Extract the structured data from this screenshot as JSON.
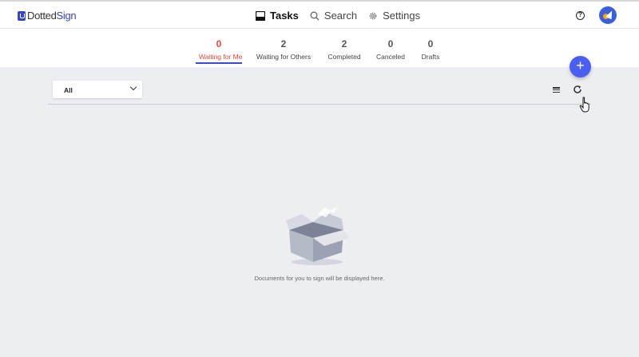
{
  "app": {
    "logo_plain": "Dotted",
    "logo_brand": "Sign"
  },
  "nav": {
    "items": [
      {
        "label": "Tasks",
        "icon": "inbox-icon",
        "active": true
      },
      {
        "label": "Search",
        "icon": "search-icon",
        "active": false
      },
      {
        "label": "Settings",
        "icon": "gear-icon",
        "active": false
      }
    ],
    "help_glyph": "?"
  },
  "status_tabs": [
    {
      "count": "0",
      "label": "Waiting for Me",
      "active": true
    },
    {
      "count": "2",
      "label": "Waiting for Others",
      "active": false
    },
    {
      "count": "2",
      "label": "Completed",
      "active": false
    },
    {
      "count": "0",
      "label": "Canceled",
      "active": false
    },
    {
      "count": "0",
      "label": "Drafts",
      "active": false
    }
  ],
  "fab": {
    "glyph": "+"
  },
  "filter": {
    "selected": "All"
  },
  "empty_state": {
    "message": "Documents for you to sign will be displayed here."
  },
  "colors": {
    "accent": "#4a5ff0",
    "active_tab": "#e0483c",
    "background": "#eceef2"
  }
}
